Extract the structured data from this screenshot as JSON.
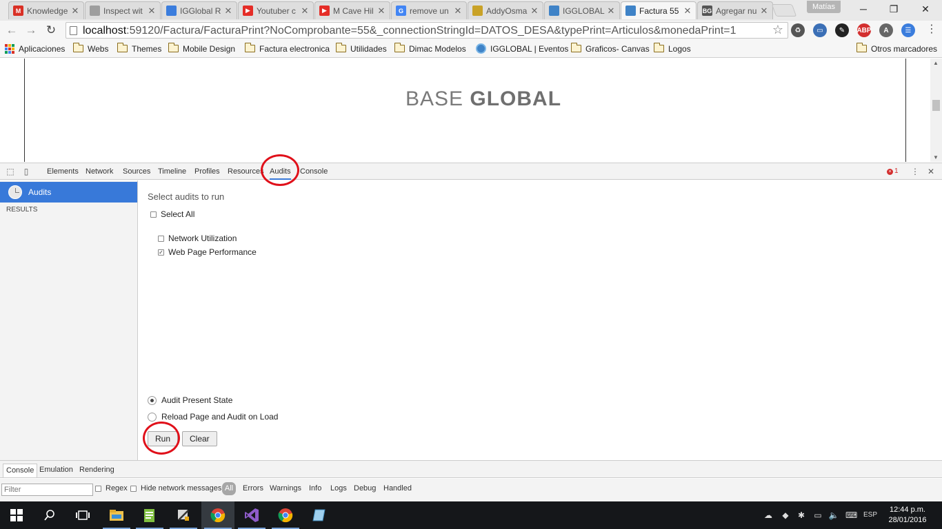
{
  "browser": {
    "tabs": [
      {
        "title": "Knowledge",
        "icon": "gmail-icon",
        "color": "#d93025",
        "glyph": "M"
      },
      {
        "title": "Inspect wit",
        "icon": "page-icon",
        "color": "#9e9e9e",
        "glyph": ""
      },
      {
        "title": "IGGlobal R",
        "icon": "iggl-icon",
        "color": "#3b7ddd",
        "glyph": ""
      },
      {
        "title": "Youtuber c",
        "icon": "youtube-icon",
        "color": "#e52d27",
        "glyph": "▶"
      },
      {
        "title": "M Cave Hil",
        "icon": "youtube-icon",
        "color": "#e52d27",
        "glyph": "▶"
      },
      {
        "title": "remove un",
        "icon": "google-icon",
        "color": "#4285f4",
        "glyph": "G"
      },
      {
        "title": "AddyOsma",
        "icon": "avatar-icon",
        "color": "#c9a227",
        "glyph": ""
      },
      {
        "title": "IGGLOBAL",
        "icon": "globe-icon",
        "color": "#3f83c7",
        "glyph": ""
      },
      {
        "title": "Factura 55",
        "icon": "globe-icon",
        "color": "#3f83c7",
        "glyph": ""
      },
      {
        "title": "Agregar nu",
        "icon": "bg-icon",
        "color": "#555555",
        "glyph": "BG"
      }
    ],
    "active_tab": 8,
    "profile_name": "Matías",
    "url_host": "localhost",
    "url_rest": ":59120/Factura/FacturaPrint?NoComprobante=55&_connectionStringId=DATOS_DESA&typePrint=Articulos&monedaPrint=1",
    "bookmarks": [
      {
        "label": "Aplicaciones",
        "icon": "apps-icon"
      },
      {
        "label": "Webs",
        "icon": "folder-icon"
      },
      {
        "label": "Themes",
        "icon": "folder-icon"
      },
      {
        "label": "Mobile Design",
        "icon": "folder-icon"
      },
      {
        "label": "Factura electronica",
        "icon": "folder-icon"
      },
      {
        "label": "Utilidades",
        "icon": "folder-icon"
      },
      {
        "label": "Dimac Modelos",
        "icon": "folder-icon"
      },
      {
        "label": "IGGLOBAL | Eventos",
        "icon": "globe-icon"
      },
      {
        "label": "Graficos- Canvas",
        "icon": "folder-icon"
      },
      {
        "label": "Logos",
        "icon": "folder-icon"
      }
    ],
    "other_bookmarks": "Otros marcadores",
    "extensions": [
      {
        "name": "recycle-icon",
        "label": "♻",
        "color": "#555555"
      },
      {
        "name": "cast-icon",
        "label": "▭",
        "color": "#3b6fb6"
      },
      {
        "name": "dropper-icon",
        "label": "✎",
        "color": "#222222"
      },
      {
        "name": "adblock-icon",
        "label": "ABP",
        "color": "#d32f2f"
      },
      {
        "name": "a-icon",
        "label": "A",
        "color": "#666666"
      },
      {
        "name": "shield-icon",
        "label": "☰",
        "color": "#3b7ddd"
      }
    ]
  },
  "page": {
    "logo_light": "BASE",
    "logo_bold": "GLOBAL"
  },
  "devtools": {
    "tabs": [
      "Elements",
      "Network",
      "Sources",
      "Timeline",
      "Profiles",
      "Resources",
      "Audits",
      "Console"
    ],
    "active_tab": "Audits",
    "error_count": "1",
    "sidebar": {
      "audits_label": "Audits",
      "results_label": "RESULTS"
    },
    "audits": {
      "title": "Select audits to run",
      "select_all": "Select All",
      "select_all_checked": false,
      "items": [
        {
          "label": "Network Utilization",
          "checked": false
        },
        {
          "label": "Web Page Performance",
          "checked": true
        }
      ],
      "mode_options": [
        {
          "label": "Audit Present State",
          "selected": true
        },
        {
          "label": "Reload Page and Audit on Load",
          "selected": false
        }
      ],
      "run_label": "Run",
      "clear_label": "Clear"
    },
    "drawer": {
      "tabs": [
        "Console",
        "Emulation",
        "Rendering"
      ],
      "active_tab": "Console",
      "filter_placeholder": "Filter",
      "regex_label": "Regex",
      "hide_network_label": "Hide network messages",
      "levels": [
        "All",
        "Errors",
        "Warnings",
        "Info",
        "Logs",
        "Debug",
        "Handled"
      ]
    }
  },
  "taskbar": {
    "time": "12:44 p.m.",
    "date": "28/01/2016",
    "language": "ESP",
    "apps": [
      {
        "name": "start-icon"
      },
      {
        "name": "search-icon"
      },
      {
        "name": "task-view-icon"
      },
      {
        "name": "file-explorer-icon"
      },
      {
        "name": "notepad-icon"
      },
      {
        "name": "tools-icon"
      },
      {
        "name": "chrome-icon"
      },
      {
        "name": "visual-studio-icon"
      },
      {
        "name": "chrome-icon"
      },
      {
        "name": "app-icon"
      }
    ]
  },
  "annotations": {
    "color": "#e0101a"
  }
}
